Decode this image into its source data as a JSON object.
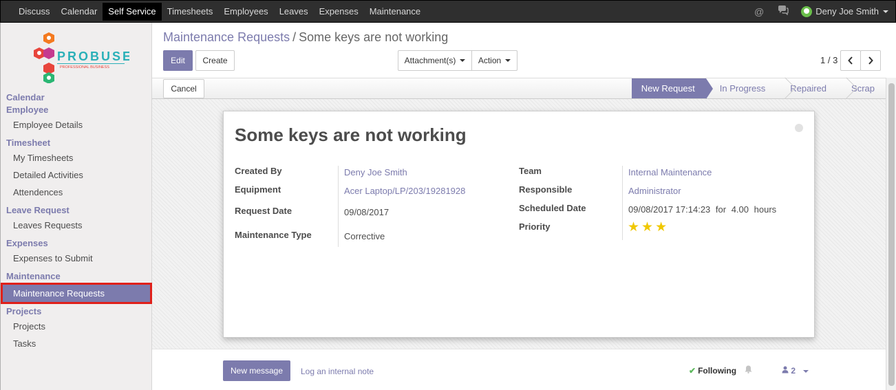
{
  "topbar": {
    "menu": [
      "Discuss",
      "Calendar",
      "Self Service",
      "Timesheets",
      "Employees",
      "Leaves",
      "Expenses",
      "Maintenance"
    ],
    "active_menu": "Self Service",
    "user_name": "Deny Joe Smith"
  },
  "sidebar": {
    "logo_text": "PROBUSE",
    "logo_tagline": "PROFESSIONAL BUSINESS",
    "sections": [
      {
        "head": "Calendar",
        "items": []
      },
      {
        "head": "Employee",
        "items": [
          "Employee Details"
        ]
      },
      {
        "head": "Timesheet",
        "items": [
          "My Timesheets",
          "Detailed Activities",
          "Attendences"
        ]
      },
      {
        "head": "Leave Request",
        "items": [
          "Leaves Requests"
        ]
      },
      {
        "head": "Expenses",
        "items": [
          "Expenses to Submit"
        ]
      },
      {
        "head": "Maintenance",
        "items": [
          "Maintenance Requests"
        ]
      },
      {
        "head": "Projects",
        "items": [
          "Projects",
          "Tasks"
        ]
      }
    ],
    "active_item": "Maintenance Requests"
  },
  "control_panel": {
    "breadcrumb_parent": "Maintenance Requests",
    "breadcrumb_separator": "/",
    "breadcrumb_current": "Some keys are not working",
    "edit_label": "Edit",
    "create_label": "Create",
    "attachments_label": "Attachment(s)",
    "action_label": "Action",
    "pager": "1 / 3"
  },
  "statusbar": {
    "cancel_label": "Cancel",
    "stages": [
      "New Request",
      "In Progress",
      "Repaired",
      "Scrap"
    ],
    "active_stage": "New Request"
  },
  "form": {
    "title": "Some keys are not working",
    "left_fields": [
      {
        "label": "Created By",
        "value": "Deny Joe Smith",
        "link": true
      },
      {
        "label": "Equipment",
        "value": "Acer Laptop/LP/203/19281928",
        "link": true
      },
      {
        "label": "Request Date",
        "value": "09/08/2017",
        "link": false
      },
      {
        "label": "Maintenance Type",
        "value": "Corrective",
        "link": false
      }
    ],
    "right_fields": [
      {
        "label": "Team",
        "value": "Internal Maintenance",
        "link": true
      },
      {
        "label": "Responsible",
        "value": "Administrator",
        "link": true
      },
      {
        "label": "Scheduled Date",
        "value": "09/08/2017 17:14:23",
        "link": false
      },
      {
        "label": "Priority",
        "value": "",
        "link": false
      }
    ],
    "duration_for": "for",
    "duration_value": "4.00",
    "duration_unit": "hours",
    "priority_stars": 3
  },
  "chatter": {
    "new_message_label": "New message",
    "log_note_label": "Log an internal note",
    "following_label": "Following",
    "followers_count": "2"
  },
  "colors": {
    "accent": "#7c7bad",
    "topbar": "#2f2f2f",
    "highlight_border": "#e0201a",
    "star": "#f0c800"
  }
}
